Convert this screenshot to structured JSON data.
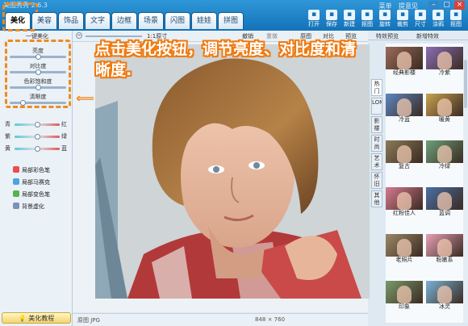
{
  "app": {
    "title": "美图秀秀 2.6.3"
  },
  "window": {
    "links": [
      "菜单",
      "提意见"
    ],
    "buttons": [
      "minimize-icon",
      "restore-icon",
      "close-icon"
    ]
  },
  "tabs": [
    {
      "label": "美化",
      "active": true
    },
    {
      "label": "美容"
    },
    {
      "label": "饰品"
    },
    {
      "label": "文字"
    },
    {
      "label": "边框"
    },
    {
      "label": "场景"
    },
    {
      "label": "闪图"
    },
    {
      "label": "娃娃"
    },
    {
      "label": "拼图"
    }
  ],
  "toolbar": [
    {
      "label": "打开",
      "icon": "folder-icon"
    },
    {
      "label": "保存",
      "icon": "save-icon"
    },
    {
      "label": "新建",
      "icon": "new-icon"
    },
    {
      "label": "抠图",
      "icon": "cutout-icon"
    },
    {
      "label": "旋转",
      "icon": "rotate-icon"
    },
    {
      "label": "裁剪",
      "icon": "crop-icon"
    },
    {
      "label": "尺寸",
      "icon": "resize-icon"
    },
    {
      "label": "涂鸦",
      "icon": "scribble-icon"
    },
    {
      "label": "抠图",
      "icon": "pen-icon"
    }
  ],
  "left_panel": {
    "one_click": "一键美化",
    "sliders": [
      {
        "label": "亮度",
        "value": 0.5
      },
      {
        "label": "对比度",
        "value": 0.5
      },
      {
        "label": "色彩饱和度",
        "value": 0.5
      },
      {
        "label": "清晰度",
        "value": 0.2
      }
    ],
    "color_sliders": [
      {
        "left": "青",
        "right": "红"
      },
      {
        "left": "紫",
        "right": "绿"
      },
      {
        "left": "黄",
        "right": "蓝"
      }
    ],
    "tools": [
      {
        "label": "局部彩色笔",
        "color": "#e94d4d"
      },
      {
        "label": "局部马赛克",
        "color": "#4aa6e0"
      },
      {
        "label": "局部变色笔",
        "color": "#56b34a"
      },
      {
        "label": "背景虚化",
        "color": "#7e8fb8"
      }
    ],
    "tutorial": "美化教程"
  },
  "canvas_toolbar": {
    "zoom": "1:1原寸",
    "actions": [
      "撤销",
      "重做",
      "原图",
      "对比",
      "预览"
    ]
  },
  "status": {
    "left": "原图 JPG",
    "size": "848 × 760"
  },
  "effects_panel": {
    "tabs": [
      "特效预览",
      "新增特效"
    ],
    "categories": [
      "热门",
      "LOMO",
      "影楼",
      "时尚",
      "艺术",
      "怀旧",
      "其他"
    ],
    "items": [
      {
        "label": "经典影楼",
        "tint": "#9a6b5a"
      },
      {
        "label": "冷紫",
        "tint": "#8a6fb5"
      },
      {
        "label": "冷蓝",
        "tint": "#5d86c1"
      },
      {
        "label": "暖黄",
        "tint": "#c9a24f"
      },
      {
        "label": "复古",
        "tint": "#8a7b58"
      },
      {
        "label": "冷绿",
        "tint": "#6da07a"
      },
      {
        "label": "红粉佳人",
        "tint": "#d77a8f"
      },
      {
        "label": "蓝调",
        "tint": "#4a6fa5"
      },
      {
        "label": "老照片",
        "tint": "#9b8866"
      },
      {
        "label": "粉嫩系",
        "tint": "#e9a0b5"
      },
      {
        "label": "印象",
        "tint": "#7a9a6a"
      },
      {
        "label": "冰灵",
        "tint": "#7ab3d6"
      }
    ]
  },
  "annotation": {
    "text": "点击美化按钮，调节亮度、对比度和清晰度."
  }
}
